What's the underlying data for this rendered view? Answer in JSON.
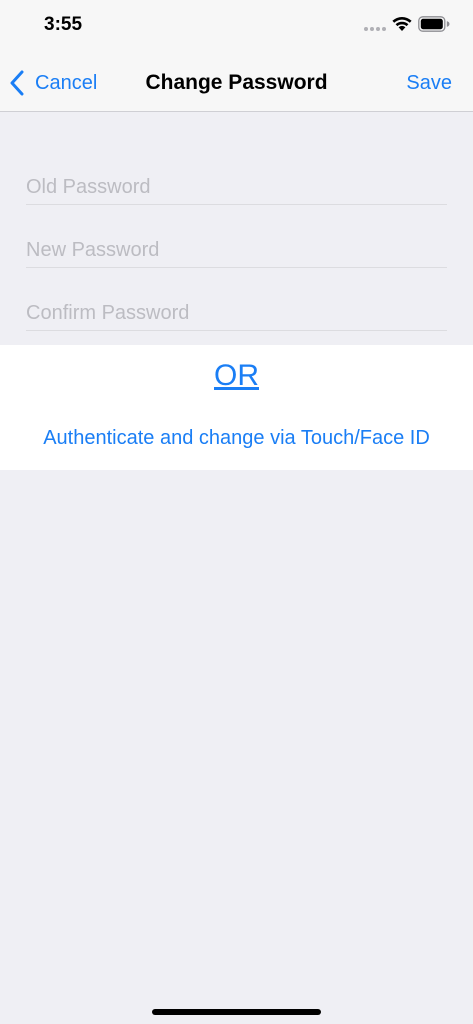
{
  "status_bar": {
    "time": "3:55",
    "icons": [
      "signal-dots-icon",
      "wifi-icon",
      "battery-icon"
    ]
  },
  "nav_bar": {
    "back_label": "Cancel",
    "title": "Change Password",
    "save_label": "Save",
    "accent_color": "#1a7ef5"
  },
  "form": {
    "old_password": {
      "placeholder": "Old Password",
      "value": ""
    },
    "new_password": {
      "placeholder": "New Password",
      "value": ""
    },
    "confirm_password": {
      "placeholder": "Confirm Password",
      "value": ""
    }
  },
  "alternative": {
    "or_label": "OR",
    "biometric_label": "Authenticate and change via Touch/Face ID"
  }
}
